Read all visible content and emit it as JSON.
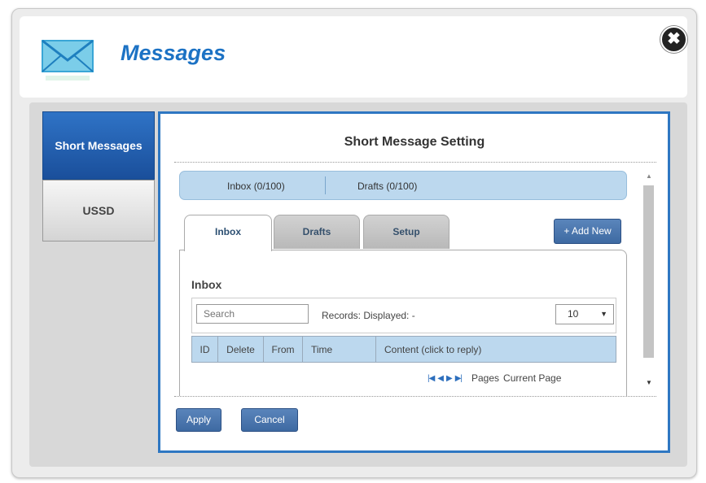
{
  "dialog": {
    "title": "Messages",
    "close_label": "✖"
  },
  "sidebar": {
    "items": [
      {
        "label": "Short Messages",
        "active": true
      },
      {
        "label": "USSD",
        "active": false
      }
    ]
  },
  "main": {
    "section_title": "Short Message Setting",
    "summary": {
      "inbox": "Inbox (0/100)",
      "drafts": "Drafts (0/100)"
    },
    "tabs": [
      {
        "label": "Inbox",
        "active": true
      },
      {
        "label": "Drafts",
        "active": false
      },
      {
        "label": "Setup",
        "active": false
      }
    ],
    "add_new_label": "+ Add New",
    "panel_heading": "Inbox",
    "search": {
      "placeholder": "Search",
      "value": ""
    },
    "records_text": "Records:  Displayed: -",
    "page_size": "10",
    "table": {
      "columns": [
        "ID",
        "Delete",
        "From",
        "Time",
        "Content (click to reply)"
      ],
      "rows": []
    },
    "pager": {
      "pages_label": "Pages",
      "current_page_label": "Current Page"
    },
    "buttons": {
      "apply": "Apply",
      "cancel": "Cancel"
    }
  },
  "colors": {
    "accent": "#1c72c4",
    "frame": "#2e77c2",
    "active_tab": "#1a4f9b",
    "summary_bg": "#bcd8ee"
  }
}
